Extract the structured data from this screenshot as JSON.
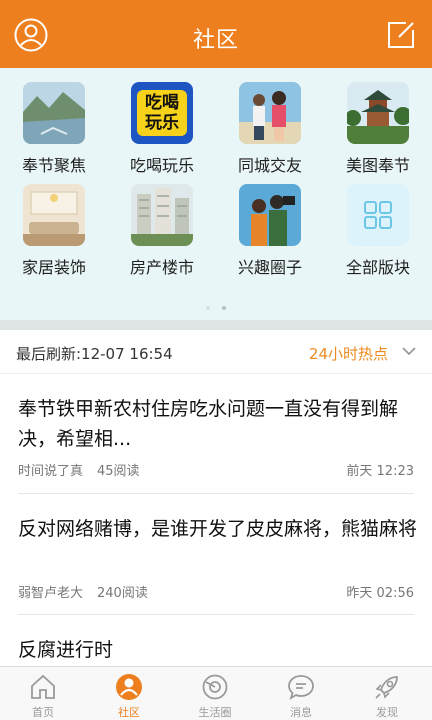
{
  "header": {
    "title": "社区"
  },
  "forums": [
    {
      "label": "奉节聚焦",
      "icon": "river-photo"
    },
    {
      "label": "吃喝玩乐",
      "icon": "food-fun-badge",
      "badge_text": "吃喝玩乐"
    },
    {
      "label": "同城交友",
      "icon": "couple-photo"
    },
    {
      "label": "美图奉节",
      "icon": "pavilion-photo"
    },
    {
      "label": "家居装饰",
      "icon": "interior-photo"
    },
    {
      "label": "房产楼市",
      "icon": "buildings-photo"
    },
    {
      "label": "兴趣圈子",
      "icon": "camera-people-photo"
    },
    {
      "label": "全部版块",
      "icon": "grid-icon"
    }
  ],
  "pager": {
    "pages": 2,
    "current": 2
  },
  "feed": {
    "refresh_text": "最后刷新:12-07 16:54",
    "filter_label": "24小时热点",
    "posts": [
      {
        "title": "奉节铁甲新农村住房吃水问题一直没有得到解决，希望相...",
        "author": "时间说了真",
        "reads": "45阅读",
        "time": "前天 12:23"
      },
      {
        "title": "反对网络赌博，是谁开发了皮皮麻将，熊猫麻将",
        "author": "弱智卢老大",
        "reads": "240阅读",
        "time": "昨天 02:56"
      },
      {
        "title": "反腐进行时"
      }
    ]
  },
  "tabs": [
    {
      "label": "首页",
      "icon": "home-icon"
    },
    {
      "label": "社区",
      "icon": "community-icon",
      "active": true
    },
    {
      "label": "生活圈",
      "icon": "life-circle-icon"
    },
    {
      "label": "消息",
      "icon": "message-icon"
    },
    {
      "label": "发现",
      "icon": "rocket-icon"
    }
  ],
  "colors": {
    "brand": "#ee7f1e",
    "hot": "#ee8a1e",
    "panel": "#e9f6f7"
  }
}
